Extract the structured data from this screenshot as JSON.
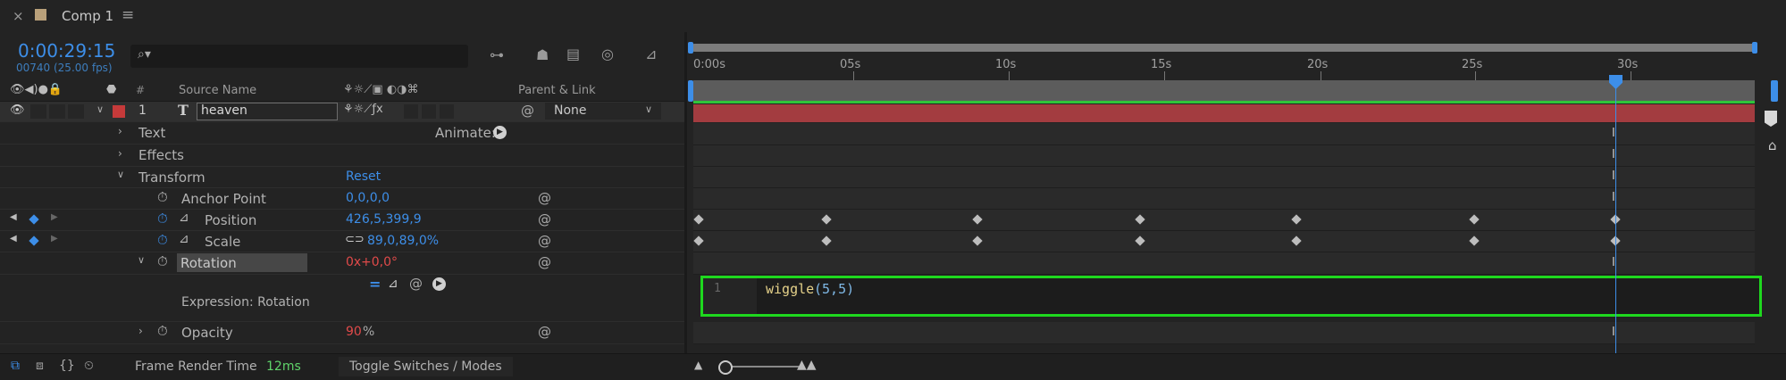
{
  "tab": {
    "title": "Comp 1"
  },
  "timecode": {
    "current": "0:00:29:15",
    "frame_info": "00740 (25.00 fps)"
  },
  "search": {
    "placeholder": ""
  },
  "columns": {
    "number": "#",
    "source_name": "Source Name",
    "parent_link": "Parent & Link"
  },
  "layer": {
    "index": "1",
    "type_icon": "T",
    "name": "heaven",
    "parent": "None",
    "label_color": "#c53a3a"
  },
  "properties": {
    "text": "Text",
    "animate": "Animate:",
    "effects": "Effects",
    "transform": "Transform",
    "reset": "Reset",
    "anchor_point": {
      "label": "Anchor Point",
      "value": "0,0,0,0"
    },
    "position": {
      "label": "Position",
      "value": "426,5,399,9"
    },
    "scale": {
      "label": "Scale",
      "value": "89,0,89,0%"
    },
    "rotation": {
      "label": "Rotation",
      "value_turns": "0x",
      "value_deg": "+0,0°"
    },
    "expression": {
      "label": "Expression: Rotation"
    },
    "opacity": {
      "label": "Opacity",
      "value": "90",
      "unit": "%"
    }
  },
  "ruler": {
    "ticks": [
      "0:00s",
      "05s",
      "10s",
      "15s",
      "20s",
      "25s",
      "30s"
    ]
  },
  "expression_code": {
    "line_number": "1",
    "code_fn": "wiggle",
    "code_args": "(5,5)"
  },
  "bottom": {
    "frame_render_label": "Frame Render Time",
    "frame_render_value": "12ms",
    "toggle": "Toggle Switches / Modes"
  },
  "colors": {
    "accent": "#3d8ee8",
    "layer_bar": "#a33c40",
    "highlight_box": "#1ed81e",
    "green_bar": "#2fc43a"
  }
}
